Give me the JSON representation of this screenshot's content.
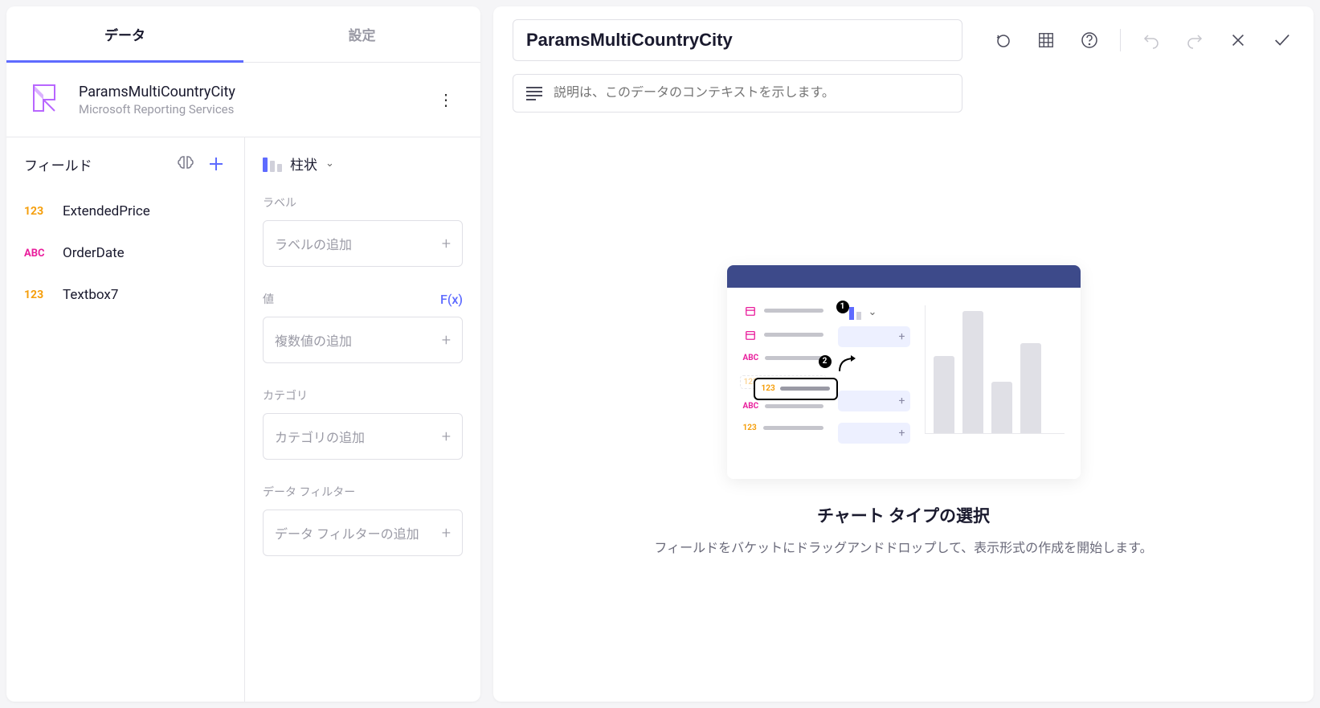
{
  "sidebar": {
    "tabs": {
      "data": "データ",
      "settings": "設定"
    },
    "datasource": {
      "title": "ParamsMultiCountryCity",
      "subtitle": "Microsoft Reporting Services"
    },
    "fields": {
      "header": "フィールド",
      "items": [
        {
          "type": "123",
          "typeClass": "num",
          "name": "ExtendedPrice"
        },
        {
          "type": "ABC",
          "typeClass": "abc",
          "name": "OrderDate"
        },
        {
          "type": "123",
          "typeClass": "num",
          "name": "Textbox7"
        }
      ]
    },
    "config": {
      "chartType": "柱状",
      "labelSection": "ラベル",
      "labelPlaceholder": "ラベルの追加",
      "valueSection": "値",
      "valuePlaceholder": "複数値の追加",
      "fx": "F(x)",
      "categorySection": "カテゴリ",
      "categoryPlaceholder": "カテゴリの追加",
      "filterSection": "データ フィルター",
      "filterPlaceholder": "データ フィルターの追加"
    }
  },
  "main": {
    "title": "ParamsMultiCountryCity",
    "descriptionPlaceholder": "説明は、このデータのコンテキストを示します。",
    "canvas": {
      "title": "チャート タイプの選択",
      "subtitle": "フィールドをバケットにドラッグアンドドロップして、表示形式の作成を開始します。"
    }
  }
}
